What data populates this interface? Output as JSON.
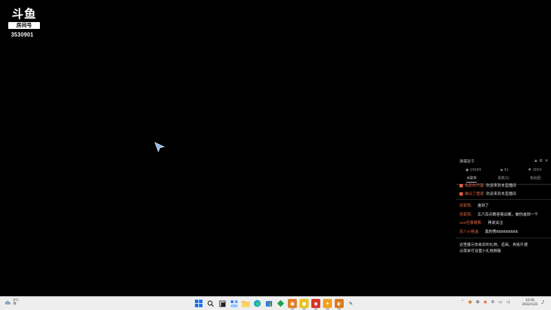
{
  "watermark": {
    "brand": "斗鱼",
    "room_label": "房间号",
    "room_number": "3530901"
  },
  "chat_panel": {
    "title": "弹幕助手",
    "tools": [
      "lock-icon",
      "gear-icon",
      "close-icon"
    ],
    "stats": [
      {
        "icon": "user-icon",
        "value": "19184"
      },
      {
        "icon": "fan-icon",
        "value": "61"
      },
      {
        "icon": "heart-icon",
        "value": "2659"
      }
    ],
    "tabs": [
      "点歌单",
      "贵宾(1)",
      "粉丝团"
    ],
    "system_messages": [
      {
        "name": "佑助你开基",
        "text": "欢迎来到本直播间"
      },
      {
        "name": "瞅尖了置梁",
        "text": "欢迎来到本直播间"
      }
    ],
    "chat_messages": [
      {
        "user": "叔家我:",
        "text": "迪到了"
      },
      {
        "user": "叔家我:",
        "text": "五六百点数容易出紫，被你迪到一个"
      },
      {
        "user": "xxx任泰健斯:",
        "text": "再说关注"
      },
      {
        "user": "苏八小佬迪:",
        "text": "真的秀666666666"
      }
    ],
    "notice_lines": [
      "这里展示你收到的礼物、道具、贵族开通",
      "点菜单可设置小礼物屏蔽"
    ]
  },
  "taskbar": {
    "weather": {
      "temp": "9°C",
      "condition": "阴"
    },
    "apps": [
      {
        "name": "start",
        "color": "#1a73e8",
        "glyph": "⊞"
      },
      {
        "name": "search",
        "color": "transparent",
        "glyph": "⚲"
      },
      {
        "name": "task-view",
        "color": "transparent",
        "glyph": "❐"
      },
      {
        "name": "widgets",
        "color": "#3b82f6",
        "glyph": "▦"
      },
      {
        "name": "file-explorer",
        "color": "#f5c04a",
        "glyph": "▬"
      },
      {
        "name": "edge",
        "color": "#1aa2c9",
        "glyph": "e"
      },
      {
        "name": "store",
        "color": "#2a7bd6",
        "glyph": "◫"
      },
      {
        "name": "app-green",
        "color": "#1fa34a",
        "glyph": "◆"
      },
      {
        "name": "app-orange",
        "color": "#e07b24",
        "glyph": "▣"
      },
      {
        "name": "app-yellow",
        "color": "#e8c31a",
        "glyph": "●"
      },
      {
        "name": "app-red",
        "color": "#d93025",
        "glyph": "◉"
      },
      {
        "name": "app-game",
        "color": "#f0a020",
        "glyph": "✦"
      },
      {
        "name": "app-orange2",
        "color": "#d97a1a",
        "glyph": "◐"
      },
      {
        "name": "app-pen",
        "color": "transparent",
        "glyph": "✎"
      }
    ],
    "tray_icons": [
      "chevron-up-icon",
      "app-tray-icon",
      "app-tray-icon",
      "app-tray-icon",
      "app-tray-icon",
      "network-icon",
      "speaker-icon"
    ],
    "clock": {
      "time": "10:56",
      "date": "2022/1/21"
    }
  },
  "colors": {
    "background": "#000000",
    "chat_username": "#e0663f",
    "taskbar": "#eeeeee"
  }
}
